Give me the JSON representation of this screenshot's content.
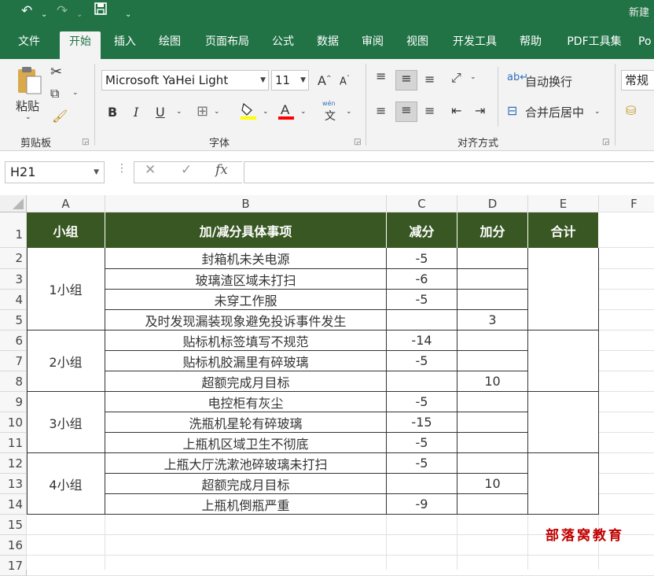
{
  "titlebar": {
    "undo_icon": "undo-icon",
    "redo_icon": "redo-icon",
    "save_icon": "save-icon",
    "customize_icon": "chevron-down-icon",
    "title": "新建"
  },
  "tabs": [
    "文件",
    "开始",
    "插入",
    "绘图",
    "页面布局",
    "公式",
    "数据",
    "审阅",
    "视图",
    "开发工具",
    "帮助",
    "PDF工具集",
    "Po"
  ],
  "ribbon": {
    "clipboard": {
      "paste_label": "粘贴",
      "label": "剪贴板"
    },
    "font": {
      "font_name": "Microsoft YaHei Light",
      "font_size": "11",
      "label": "字体",
      "bold": "B",
      "italic": "I",
      "underline": "U",
      "fill_color": "#ffff00",
      "font_color": "#ff0000",
      "phonetic": "wén",
      "phonetic_char": "文"
    },
    "alignment": {
      "wrap_text": "自动换行",
      "merge_center": "合并后居中",
      "label": "对齐方式"
    },
    "number": {
      "format": "常规"
    }
  },
  "formula_bar": {
    "name_box": "H21",
    "cancel": "✕",
    "enter": "✓",
    "fx": "fx",
    "value": ""
  },
  "sheet": {
    "columns": [
      "A",
      "B",
      "C",
      "D",
      "E",
      "F"
    ],
    "rows": [
      "1",
      "2",
      "3",
      "4",
      "5",
      "6",
      "7",
      "8",
      "9",
      "10",
      "11",
      "12",
      "13",
      "14",
      "15",
      "16",
      "17"
    ],
    "header": {
      "group": "小组",
      "item": "加/减分具体事项",
      "minus": "减分",
      "plus": "加分",
      "total": "合计"
    },
    "header_color": "#385723",
    "groups": [
      {
        "name": "1小组"
      },
      {
        "name": "2小组"
      },
      {
        "name": "3小组"
      },
      {
        "name": "4小组"
      }
    ],
    "items": [
      {
        "desc": "封箱机未关电源",
        "minus": "-5",
        "plus": ""
      },
      {
        "desc": "玻璃渣区域未打扫",
        "minus": "-6",
        "plus": ""
      },
      {
        "desc": "未穿工作服",
        "minus": "-5",
        "plus": ""
      },
      {
        "desc": "及时发现漏装现象避免投诉事件发生",
        "minus": "",
        "plus": "3"
      },
      {
        "desc": "贴标机标签填写不规范",
        "minus": "-14",
        "plus": ""
      },
      {
        "desc": "贴标机胶漏里有碎玻璃",
        "minus": "-5",
        "plus": ""
      },
      {
        "desc": "超额完成月目标",
        "minus": "",
        "plus": "10"
      },
      {
        "desc": "电控柜有灰尘",
        "minus": "-5",
        "plus": ""
      },
      {
        "desc": "洗瓶机星轮有碎玻璃",
        "minus": "-15",
        "plus": ""
      },
      {
        "desc": "上瓶机区域卫生不彻底",
        "minus": "-5",
        "plus": ""
      },
      {
        "desc": "上瓶大厅洗漱池碎玻璃未打扫",
        "minus": "-5",
        "plus": ""
      },
      {
        "desc": "超额完成月目标",
        "minus": "",
        "plus": "10"
      },
      {
        "desc": "上瓶机倒瓶严重",
        "minus": "-9",
        "plus": ""
      }
    ],
    "watermark": "部落窝教育"
  }
}
